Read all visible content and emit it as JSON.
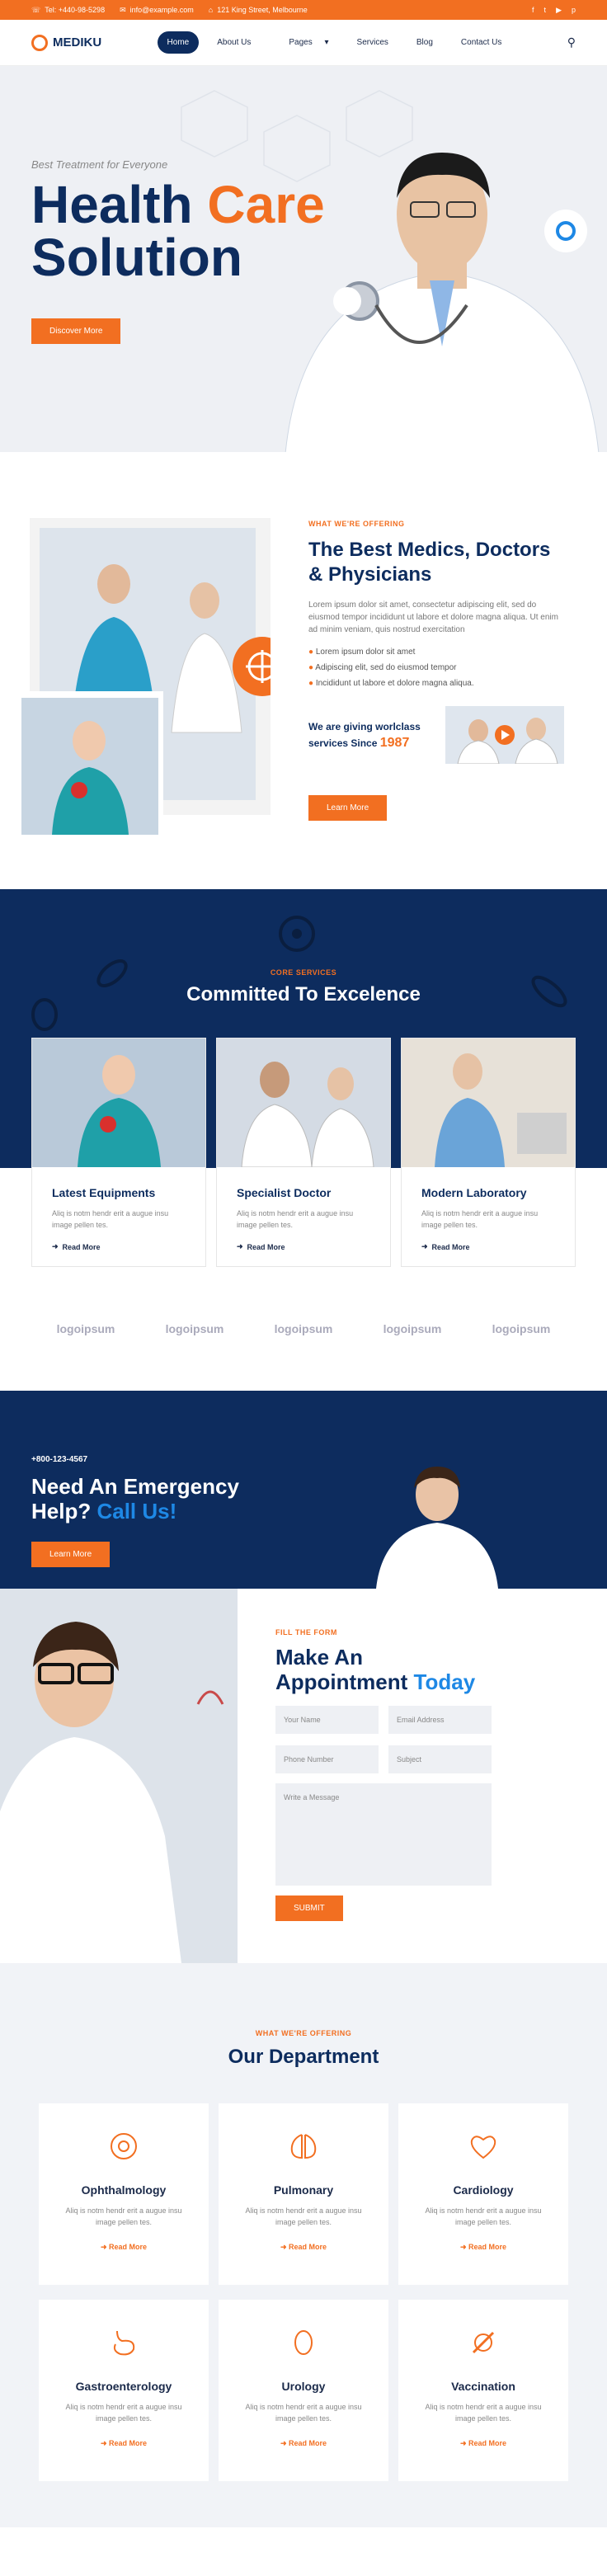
{
  "topbar": {
    "phone": "Tel: +440-98-5298",
    "email": "info@example.com",
    "address": "121 King Street, Melbourne"
  },
  "logo": {
    "name": "MEDIKU"
  },
  "nav": {
    "items": [
      "Home",
      "About Us",
      "Pages",
      "Services",
      "Blog",
      "Contact Us"
    ]
  },
  "hero": {
    "subtitle": "Best Treatment for Everyone",
    "title_1": "Health",
    "title_2": "Care",
    "title_3": "Solution",
    "button": "Discover More"
  },
  "about": {
    "tag": "WHAT WE'RE OFFERING",
    "title": "The Best Medics, Doctors & Physicians",
    "text": "Lorem ipsum dolor sit amet, consectetur adipiscing elit, sed do eiusmod tempor incididunt ut labore et dolore magna aliqua. Ut enim ad minim veniam, quis nostrud exercitation",
    "list": [
      "Lorem ipsum dolor sit amet",
      "Adipiscing elit, sed do eiusmod tempor",
      "Incididunt ut labore et dolore magna aliqua."
    ],
    "since_text": "We are giving worlclass services Since",
    "since_year": "1987",
    "button": "Learn More"
  },
  "services": {
    "tag": "CORE SERVICES",
    "title": "Committed To Excelence",
    "cards": [
      {
        "title": "Latest Equipments",
        "text": "Aliq is notm hendr erit a augue insu image pellen tes.",
        "link": "Read More"
      },
      {
        "title": "Specialist Doctor",
        "text": "Aliq is notm hendr erit a augue insu image pellen tes.",
        "link": "Read More"
      },
      {
        "title": "Modern Laboratory",
        "text": "Aliq is notm hendr erit a augue insu image pellen tes.",
        "link": "Read More"
      }
    ]
  },
  "logos": [
    "logoipsum",
    "logoipsum",
    "logoipsum",
    "logoipsum",
    "logoipsum"
  ],
  "emergency": {
    "phone": "+800-123-4567",
    "title_1": "Need An Emergency",
    "title_2": "Help?",
    "title_3": "Call Us!",
    "button": "Learn More"
  },
  "appointment": {
    "tag": "FILL THE FORM",
    "title_1": "Make An",
    "title_2": "Appointment",
    "title_3": "Today",
    "name": "Your Name",
    "email": "Email Address",
    "phone": "Phone Number",
    "subject": "Subject",
    "message": "Write a Message",
    "button": "SUBMIT"
  },
  "department": {
    "tag": "WHAT WE'RE OFFERING",
    "title": "Our Department",
    "items": [
      {
        "title": "Ophthalmology",
        "text": "Aliq is notm hendr erit a augue insu image pellen tes.",
        "link": "Read More"
      },
      {
        "title": "Pulmonary",
        "text": "Aliq is notm hendr erit a augue insu image pellen tes.",
        "link": "Read More"
      },
      {
        "title": "Cardiology",
        "text": "Aliq is notm hendr erit a augue insu image pellen tes.",
        "link": "Read More"
      },
      {
        "title": "Gastroenterology",
        "text": "Aliq is notm hendr erit a augue insu image pellen tes.",
        "link": "Read More"
      },
      {
        "title": "Urology",
        "text": "Aliq is notm hendr erit a augue insu image pellen tes.",
        "link": "Read More"
      },
      {
        "title": "Vaccination",
        "text": "Aliq is notm hendr erit a augue insu image pellen tes.",
        "link": "Read More"
      }
    ]
  },
  "colors": {
    "accent": "#f26f21",
    "navy": "#0d2c5e",
    "blue": "#1e88e5"
  }
}
